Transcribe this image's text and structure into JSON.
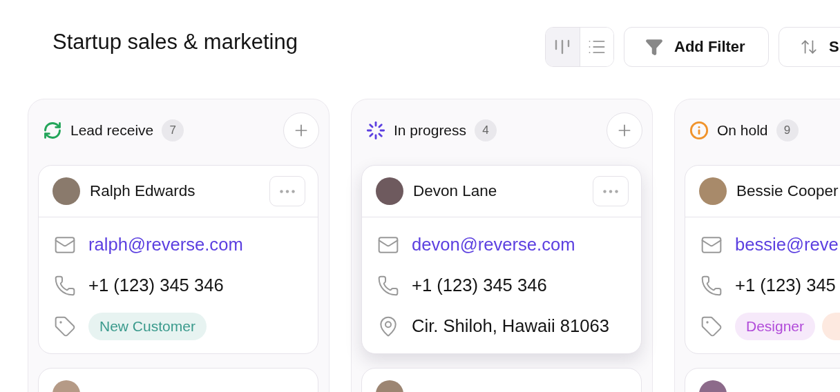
{
  "title": "Startup sales & marketing",
  "view_toggle": [
    {
      "kind": "board",
      "selected": true
    },
    {
      "kind": "list",
      "selected": false
    }
  ],
  "toolbar_buttons": [
    {
      "kind": "filter",
      "label": "Add Filter"
    },
    {
      "kind": "sort",
      "label": "S"
    }
  ],
  "columns": [
    {
      "title": "Lead receive",
      "count": "7",
      "kind": "refresh",
      "color": "#23a55a",
      "cards": [
        {
          "name": "Ralph Edwards",
          "raised": false,
          "rows": [
            {
              "kind": "email",
              "text": "ralph@reverse.com"
            },
            {
              "kind": "phone",
              "text": "+1 (123) 345 346"
            },
            {
              "kind": "tags",
              "tags": [
                {
                  "label": "New Customer",
                  "color": "#3a9a8c"
                }
              ]
            }
          ]
        },
        {
          "raised": false
        }
      ]
    },
    {
      "title": "In progress",
      "count": "4",
      "kind": "loader",
      "color": "#5b3fe0",
      "cards": [
        {
          "name": "Devon Lane",
          "raised": true,
          "rows": [
            {
              "kind": "email",
              "text": "devon@reverse.com"
            },
            {
              "kind": "phone",
              "text": "+1 (123) 345 346"
            },
            {
              "kind": "location",
              "text": "Cir. Shiloh, Hawaii 81063"
            }
          ]
        },
        {
          "raised": false
        }
      ]
    },
    {
      "title": "On hold",
      "count": "9",
      "kind": "info",
      "color": "#f0932b",
      "cards": [
        {
          "name": "Bessie Cooper",
          "raised": false,
          "rows": [
            {
              "kind": "email",
              "text": "bessie@reve"
            },
            {
              "kind": "phone",
              "text": "+1 (123) 345"
            },
            {
              "kind": "tags",
              "tags": [
                {
                  "label": "Designer",
                  "color": "#b14bd9"
                },
                {
                  "color": "#fde9e0"
                }
              ]
            }
          ]
        },
        {
          "raised": false
        }
      ]
    }
  ]
}
